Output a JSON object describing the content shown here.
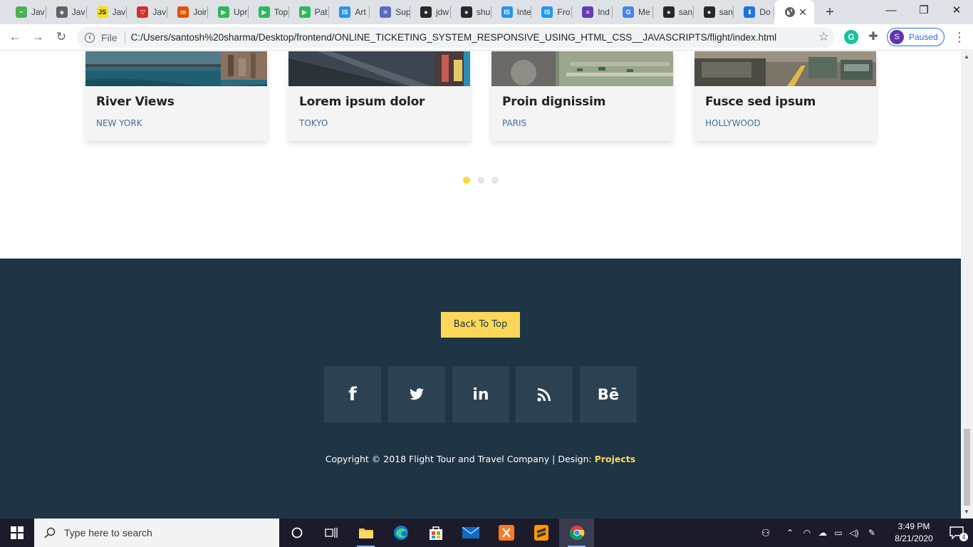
{
  "browser": {
    "tabs": [
      {
        "label": "Jav",
        "icon": "green-tab-icon",
        "color": "#4caf50",
        "glyph": "~"
      },
      {
        "label": "Jav",
        "icon": "diamond-tab-icon",
        "color": "#5f6368",
        "glyph": "◈"
      },
      {
        "label": "Jav",
        "icon": "js-tab-icon",
        "color": "#f7df1e",
        "glyph": "JS"
      },
      {
        "label": "Jav",
        "icon": "v-tab-icon",
        "color": "#d32f2f",
        "glyph": "▽"
      },
      {
        "label": "Joir",
        "icon": "m-tab-icon",
        "color": "#e65100",
        "glyph": "m"
      },
      {
        "label": "Upr",
        "icon": "play-tab-icon",
        "color": "#2eb85c",
        "glyph": "▶"
      },
      {
        "label": "Top",
        "icon": "play-tab-icon",
        "color": "#2eb85c",
        "glyph": "▶"
      },
      {
        "label": "Pat",
        "icon": "play-tab-icon",
        "color": "#2eb85c",
        "glyph": "▶"
      },
      {
        "label": "Art",
        "icon": "is-tab-icon",
        "color": "#2196f3",
        "glyph": "IS"
      },
      {
        "label": "Sup",
        "icon": "wave-tab-icon",
        "color": "#5c6bc0",
        "glyph": "≈"
      },
      {
        "label": "jdw",
        "icon": "github-tab-icon",
        "color": "#24292e",
        "glyph": "●"
      },
      {
        "label": "shu",
        "icon": "github-tab-icon",
        "color": "#24292e",
        "glyph": "●"
      },
      {
        "label": "Inte",
        "icon": "is-tab-icon",
        "color": "#2196f3",
        "glyph": "IS"
      },
      {
        "label": "Fro",
        "icon": "is-tab-icon",
        "color": "#2196f3",
        "glyph": "IS"
      },
      {
        "label": "Ind",
        "icon": "list-tab-icon",
        "color": "#673ab7",
        "glyph": "≡"
      },
      {
        "label": "Me",
        "icon": "google-tab-icon",
        "color": "#4285f4",
        "glyph": "G"
      },
      {
        "label": "san",
        "icon": "github-tab-icon",
        "color": "#24292e",
        "glyph": "●"
      },
      {
        "label": "san",
        "icon": "github-tab-icon",
        "color": "#24292e",
        "glyph": "●"
      },
      {
        "label": "Do",
        "icon": "download-tab-icon",
        "color": "#1a73e8",
        "glyph": "⬇"
      }
    ],
    "active_tab_icon": "globe-icon",
    "omnibox": {
      "file_label": "File",
      "url": "C:/Users/santosh%20sharma/Desktop/frontend/ONLINE_TICKETING_SYSTEM_RESPONSIVE_USING_HTML_CSS__JAVASCRIPTS/flight/index.html"
    },
    "profile_initial": "S",
    "profile_status": "Paused"
  },
  "destinations": [
    {
      "title": "River Views",
      "location": "NEW YORK"
    },
    {
      "title": "Lorem ipsum dolor",
      "location": "TOKYO"
    },
    {
      "title": "Proin dignissim",
      "location": "PARIS"
    },
    {
      "title": "Fusce sed ipsum",
      "location": "HOLLYWOOD"
    }
  ],
  "carousel": {
    "pages": 3,
    "active_page": 1
  },
  "footer": {
    "back_to_top": "Back To Top",
    "social": [
      {
        "name": "facebook-icon",
        "glyph": "f"
      },
      {
        "name": "twitter-icon",
        "glyph": "🐦"
      },
      {
        "name": "linkedin-icon",
        "glyph": "in"
      },
      {
        "name": "rss-icon",
        "glyph": "rss"
      },
      {
        "name": "behance-icon",
        "glyph": "Bē"
      }
    ],
    "copyright": "Copyright © 2018 Flight Tour and Travel Company | Design: ",
    "design_link": "Projects"
  },
  "taskbar": {
    "search_placeholder": "Type here to search",
    "time": "3:49 PM",
    "date": "8/21/2020",
    "notification_count": "4"
  },
  "colors": {
    "footer_bg": "#1f3445",
    "accent_yellow": "#fcd85a",
    "location_blue": "#3f6f99"
  }
}
